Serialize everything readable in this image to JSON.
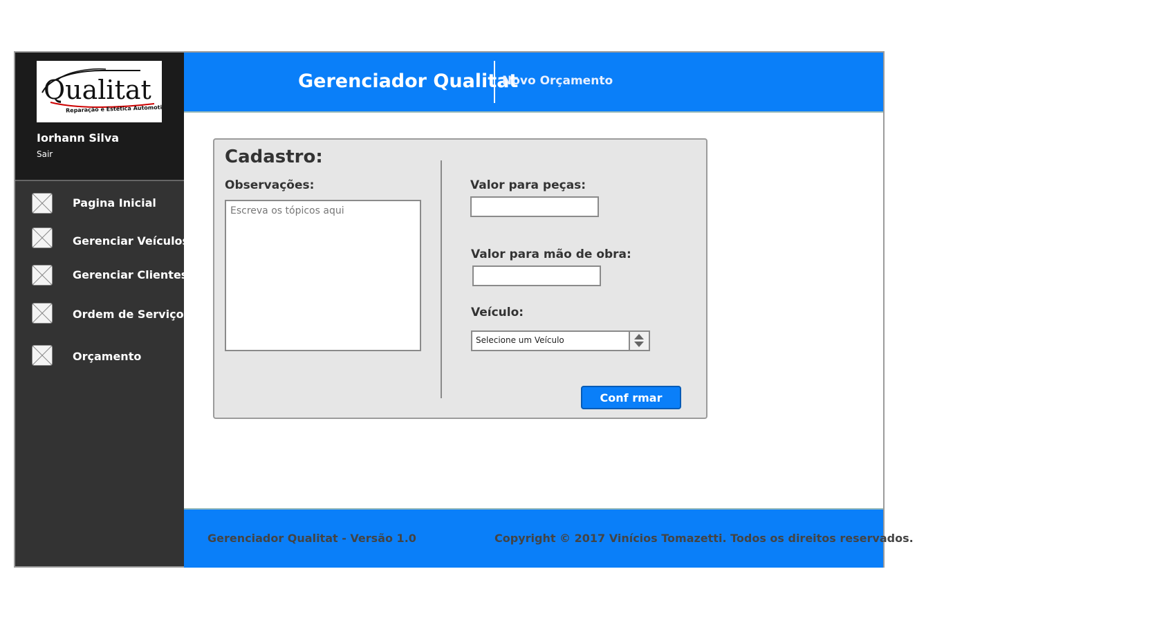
{
  "sidebar": {
    "logo": {
      "text": "Qualitat",
      "tagline": "Reparação e Estética Automotiva"
    },
    "user_name": "Iorhann Silva",
    "logout_label": "Sair",
    "items": [
      {
        "label": "Pagina Inicial",
        "icon": "placeholder-image-icon"
      },
      {
        "label": "Gerenciar Veículos",
        "icon": "placeholder-image-icon"
      },
      {
        "label": "Gerenciar Clientes",
        "icon": "placeholder-image-icon"
      },
      {
        "label": "Ordem de Serviço",
        "icon": "placeholder-image-icon"
      },
      {
        "label": "Orçamento",
        "icon": "placeholder-image-icon"
      }
    ]
  },
  "header": {
    "app_title": "Gerenciador Qualitat",
    "page_title": "Novo Orçamento"
  },
  "form": {
    "title": "Cadastro:",
    "observations_label": "Observações:",
    "observations_placeholder": "Escreva os tópicos aqui",
    "parts_value_label": "Valor para peças:",
    "parts_value": "",
    "labor_value_label": "Valor para mão de obra:",
    "labor_value": "",
    "vehicle_label": "Veículo:",
    "vehicle_selected": "Selecione um Veículo",
    "confirm_label": "Conf rmar"
  },
  "footer": {
    "version_text": "Gerenciador Qualitat - Versão 1.0",
    "copyright_text": "Copyright © 2017 Vinícios Tomazetti. Todos os direitos reservados."
  },
  "colors": {
    "primary_blue": "#0a7ff9",
    "sidebar_dark": "#333333",
    "sidebar_top": "#1b1b1b",
    "panel_gray": "#e6e6e6"
  }
}
